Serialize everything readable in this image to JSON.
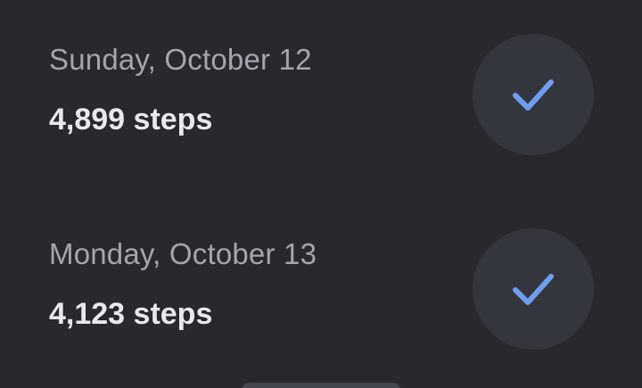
{
  "days": [
    {
      "date": "Sunday, October 12",
      "steps": "4,899 steps",
      "status_icon": "check-icon",
      "completed": true
    },
    {
      "date": "Monday, October 13",
      "steps": "4,123 steps",
      "status_icon": "check-icon",
      "completed": true
    }
  ],
  "colors": {
    "background": "#28292d",
    "check_circle": "#34363d",
    "check_mark": "#6f9ef0",
    "date_text": "#a3a6ad",
    "steps_text": "#e8e9ed"
  }
}
